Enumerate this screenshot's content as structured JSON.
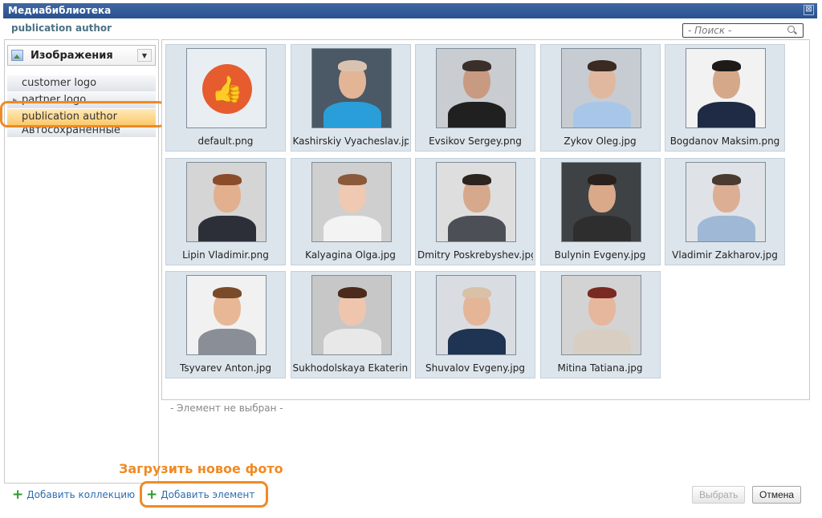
{
  "window": {
    "title": "Медиабиблиотека",
    "close_glyph": "⊠"
  },
  "header": {
    "collection_title": "publication author"
  },
  "search": {
    "placeholder": "- Поиск -"
  },
  "sidebar": {
    "type_selector": "Изображения",
    "items": [
      {
        "label": "customer logo"
      },
      {
        "label": "partner logo"
      },
      {
        "label": "publication author"
      },
      {
        "label": "Автосохраненные"
      }
    ]
  },
  "gallery": {
    "items": [
      {
        "name": "default.png",
        "icon": "thumbs-up-icon"
      },
      {
        "name": "Kashirskiy Vyacheslav.jpg"
      },
      {
        "name": "Evsikov Sergey.png"
      },
      {
        "name": "Zykov Oleg.jpg"
      },
      {
        "name": "Bogdanov Maksim.png"
      },
      {
        "name": "Lipin Vladimir.png"
      },
      {
        "name": "Kalyagina Olga.jpg"
      },
      {
        "name": "Dmitry Poskrebyshev.jpg"
      },
      {
        "name": "Bulynin Evgeny.jpg"
      },
      {
        "name": "Vladimir Zakharov.jpg"
      },
      {
        "name": "Tsyvarev Anton.jpg"
      },
      {
        "name": "Sukhodolskaya Ekaterina"
      },
      {
        "name": "Shuvalov Evgeny.jpg"
      },
      {
        "name": "Mitina Tatiana.jpg"
      }
    ]
  },
  "status": {
    "text": "- Элемент не выбран -"
  },
  "annotation": {
    "text": "Загрузить новое фото"
  },
  "footer": {
    "add_collection": "Добавить коллекцию",
    "add_element": "Добавить элемент",
    "select_label": "Выбрать",
    "cancel_label": "Отмена"
  },
  "colors": {
    "accent": "#f08a24",
    "titlebar": "#2a5190",
    "tile": "#dde5ec",
    "selected": "#fbc96b"
  }
}
